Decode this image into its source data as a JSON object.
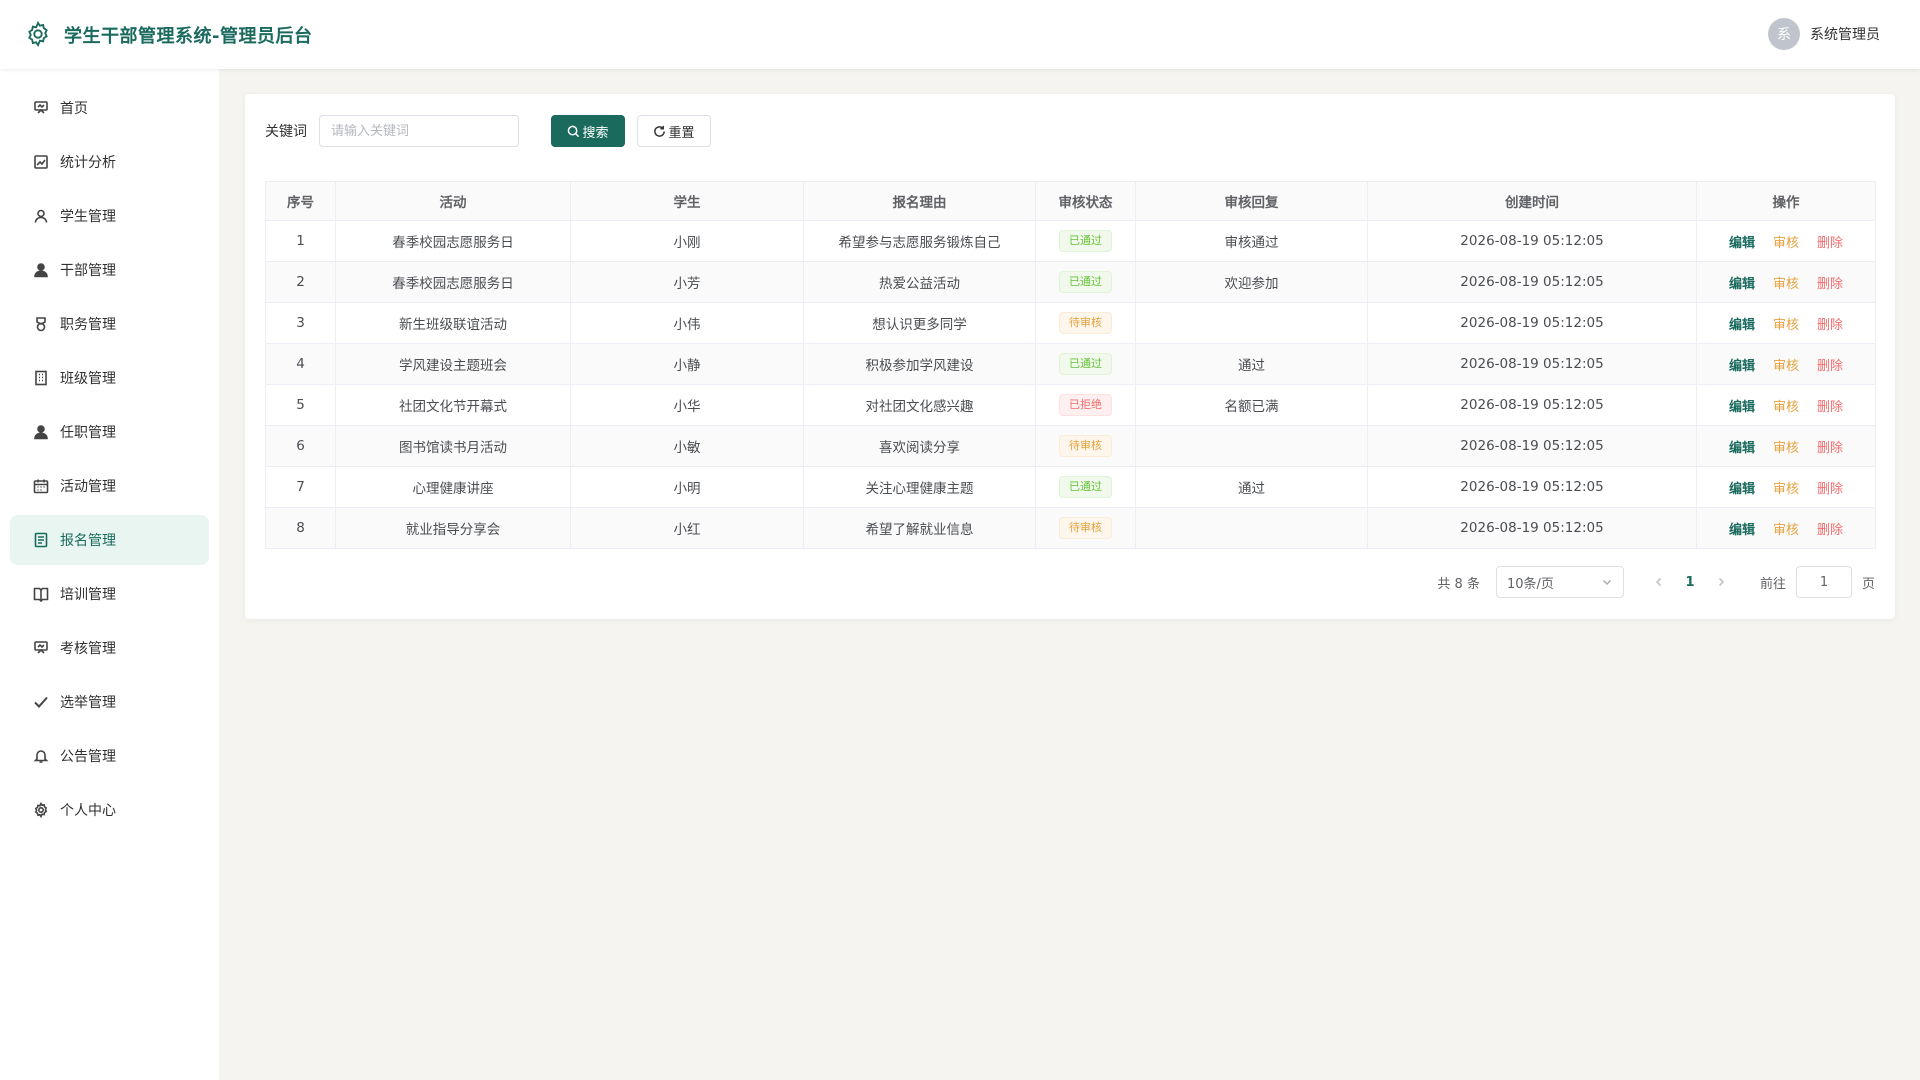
{
  "header": {
    "title": "学生干部管理系统-管理员后台",
    "avatar_text": "系",
    "user_name": "系统管理员"
  },
  "sidebar": {
    "items": [
      {
        "label": "首页",
        "icon": "dashboard-icon",
        "active": false
      },
      {
        "label": "统计分析",
        "icon": "chart-icon",
        "active": false
      },
      {
        "label": "学生管理",
        "icon": "user-icon",
        "active": false
      },
      {
        "label": "干部管理",
        "icon": "user-filled-icon",
        "active": false
      },
      {
        "label": "职务管理",
        "icon": "medal-icon",
        "active": false
      },
      {
        "label": "班级管理",
        "icon": "building-icon",
        "active": false
      },
      {
        "label": "任职管理",
        "icon": "user-filled-icon",
        "active": false
      },
      {
        "label": "活动管理",
        "icon": "calendar-icon",
        "active": false
      },
      {
        "label": "报名管理",
        "icon": "document-icon",
        "active": true
      },
      {
        "label": "培训管理",
        "icon": "book-icon",
        "active": false
      },
      {
        "label": "考核管理",
        "icon": "presentation-icon",
        "active": false
      },
      {
        "label": "选举管理",
        "icon": "check-icon",
        "active": false
      },
      {
        "label": "公告管理",
        "icon": "bell-icon",
        "active": false
      },
      {
        "label": "个人中心",
        "icon": "gear-icon",
        "active": false
      }
    ]
  },
  "search": {
    "label": "关键词",
    "placeholder": "请输入关键词",
    "search_button": "搜索",
    "reset_button": "重置"
  },
  "table": {
    "columns": [
      "序号",
      "活动",
      "学生",
      "报名理由",
      "审核状态",
      "审核回复",
      "创建时间",
      "操作"
    ],
    "rows": [
      {
        "index": "1",
        "activity": "春季校园志愿服务日",
        "student": "小刚",
        "reason": "希望参与志愿服务锻炼自己",
        "status": "已通过",
        "status_type": "success",
        "reply": "审核通过",
        "created": "2026-08-19 05:12:05"
      },
      {
        "index": "2",
        "activity": "春季校园志愿服务日",
        "student": "小芳",
        "reason": "热爱公益活动",
        "status": "已通过",
        "status_type": "success",
        "reply": "欢迎参加",
        "created": "2026-08-19 05:12:05"
      },
      {
        "index": "3",
        "activity": "新生班级联谊活动",
        "student": "小伟",
        "reason": "想认识更多同学",
        "status": "待审核",
        "status_type": "warning",
        "reply": "",
        "created": "2026-08-19 05:12:05"
      },
      {
        "index": "4",
        "activity": "学风建设主题班会",
        "student": "小静",
        "reason": "积极参加学风建设",
        "status": "已通过",
        "status_type": "success",
        "reply": "通过",
        "created": "2026-08-19 05:12:05"
      },
      {
        "index": "5",
        "activity": "社团文化节开幕式",
        "student": "小华",
        "reason": "对社团文化感兴趣",
        "status": "已拒绝",
        "status_type": "danger",
        "reply": "名额已满",
        "created": "2026-08-19 05:12:05"
      },
      {
        "index": "6",
        "activity": "图书馆读书月活动",
        "student": "小敏",
        "reason": "喜欢阅读分享",
        "status": "待审核",
        "status_type": "warning",
        "reply": "",
        "created": "2026-08-19 05:12:05"
      },
      {
        "index": "7",
        "activity": "心理健康讲座",
        "student": "小明",
        "reason": "关注心理健康主题",
        "status": "已通过",
        "status_type": "success",
        "reply": "通过",
        "created": "2026-08-19 05:12:05"
      },
      {
        "index": "8",
        "activity": "就业指导分享会",
        "student": "小红",
        "reason": "希望了解就业信息",
        "status": "待审核",
        "status_type": "warning",
        "reply": "",
        "created": "2026-08-19 05:12:05"
      }
    ],
    "actions": {
      "edit": "编辑",
      "audit": "审核",
      "delete": "删除"
    }
  },
  "pagination": {
    "total_text": "共 8 条",
    "page_size": "10条/页",
    "current_page": "1",
    "jump_prefix": "前往",
    "jump_value": "1",
    "jump_suffix": "页"
  },
  "colors": {
    "brand": "#1a6b5e",
    "success": "#67c23a",
    "warning": "#e6a23c",
    "danger": "#f56c6c"
  }
}
